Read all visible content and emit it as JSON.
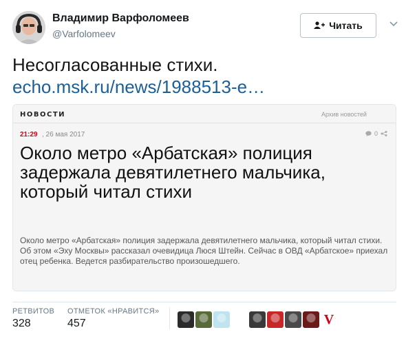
{
  "author": {
    "name": "Владимир Варфоломеев",
    "handle": "@Varfolomeev",
    "avatar_icon": "avatar-headphones-portrait"
  },
  "follow_button": {
    "label": "Читать",
    "icon": "add-user-icon"
  },
  "tweet": {
    "text": "Несогласованные стихи.",
    "link": "echo.msk.ru/news/1988513-e…"
  },
  "card": {
    "section": "НОВОСТИ",
    "archive": "Архив новостей",
    "time": "21:29",
    "date": ", 26 мая 2017",
    "comments": "0",
    "headline": "Около метро «Арбатская» полиция задержала девятилетнего мальчика, который читал стихи",
    "summary": "Около метро «Арбатская» полиция задержала девятилетнего мальчика, который читал стихи. Об этом «Эху Москвы» рассказал очевидица Люся Штейн. Сейчас в ОВД «Арбатское» приехал отец ребенка. Ведется разбирательство произошедшего."
  },
  "stats": {
    "retweets_label": "РЕТВИТОВ",
    "retweets_value": "328",
    "likes_label": "ОТМЕТОК «НРАВИТСЯ»",
    "likes_value": "457"
  },
  "likers": [
    {
      "name": "liker-avatar-1",
      "color": "#2b2b2b"
    },
    {
      "name": "liker-avatar-2",
      "color": "#5a6b3a"
    },
    {
      "name": "liker-avatar-3",
      "color": "#bfe3ef"
    },
    {
      "name": "liker-avatar-4",
      "color": "#ffffff"
    },
    {
      "name": "liker-avatar-5",
      "color": "#3a3a3a"
    },
    {
      "name": "liker-avatar-6",
      "color": "#c62828"
    },
    {
      "name": "liker-avatar-7",
      "color": "#4a4a4a"
    },
    {
      "name": "liker-avatar-8",
      "color": "#6b1a1a"
    },
    {
      "name": "liker-avatar-9",
      "color": "#ffffff",
      "text": "V"
    }
  ]
}
